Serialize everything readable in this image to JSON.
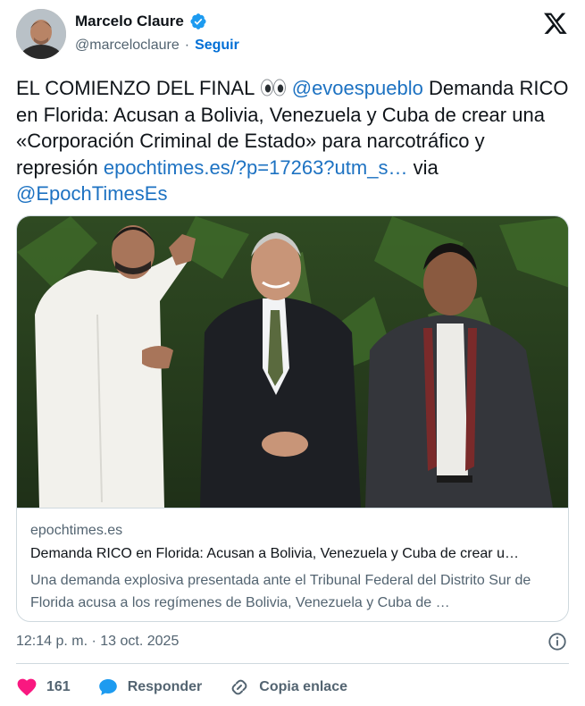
{
  "author": {
    "name": "Marcelo Claure",
    "handle": "@marceloclaure",
    "follow_label": "Seguir",
    "separator": "·"
  },
  "tweet": {
    "part1": "EL COMIENZO DEL FINAL ",
    "part2": " ",
    "mention1": "@evoespueblo",
    "part3": " Demanda RICO en Florida: Acusan a Bolivia, Venezuela y Cuba de crear una «Corporación Criminal de Estado» para narcotráfico y represión ",
    "link": "epochtimes.es/?p=17263?utm_s…",
    "part4": " via ",
    "mention2": "@EpochTimesEs"
  },
  "card": {
    "domain": "epochtimes.es",
    "title": "Demanda RICO en Florida: Acusan a Bolivia, Venezuela y Cuba de crear u…",
    "description": "Una demanda explosiva presentada ante el Tribunal Federal del Distrito Sur de Florida acusa a los regímenes de Bolivia, Venezuela y Cuba de …"
  },
  "meta": {
    "timestamp": "12:14 p. m. · 13 oct. 2025"
  },
  "actions": {
    "likes": "161",
    "reply_label": "Responder",
    "copy_label": "Copia enlace"
  },
  "colors": {
    "link": "#1d72c2",
    "follow": "#006fd6",
    "like": "#f91880",
    "reply_icon": "#1d9bf0",
    "verified": "#1d9bf0"
  },
  "icons": [
    "verified-badge-icon",
    "x-logo-icon",
    "eyes-emoji-icon",
    "info-icon",
    "heart-icon",
    "reply-bubble-icon",
    "link-icon"
  ]
}
